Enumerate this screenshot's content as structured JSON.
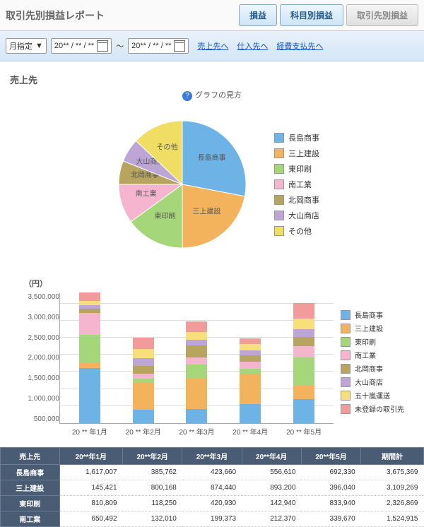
{
  "header": {
    "title": "取引先別損益レポート"
  },
  "tabs": [
    {
      "label": "損益"
    },
    {
      "label": "科目別損益"
    },
    {
      "label": "取引先別損益"
    }
  ],
  "filter": {
    "mode": "月指定",
    "date_from": "20** / ** / **",
    "date_to": "20** / ** / **",
    "sep": "～",
    "links": [
      "売上先へ",
      "仕入先へ",
      "経費支払先へ"
    ]
  },
  "section": {
    "title": "売上先",
    "howto": "グラフの見方"
  },
  "colors": {
    "長島商事": "#6db3e6",
    "三上建設": "#f2b35c",
    "東印刷": "#a6d67a",
    "南工業": "#f5b5cf",
    "北岡商事": "#b7a45e",
    "大山商店": "#bda6d6",
    "五十嵐運送": "#f7e07a",
    "その他": "#f0dd63",
    "未登録の取引先": "#f29b9b"
  },
  "pie": {
    "legend": [
      "長島商事",
      "三上建設",
      "東印刷",
      "南工業",
      "北岡商事",
      "大山商店",
      "その他"
    ],
    "slices": [
      {
        "name": "長島商事",
        "value": 28
      },
      {
        "name": "三上建設",
        "value": 22
      },
      {
        "name": "東印刷",
        "value": 15
      },
      {
        "name": "南工業",
        "value": 10
      },
      {
        "name": "北岡商事",
        "value": 6
      },
      {
        "name": "大山商店",
        "value": 6
      },
      {
        "name": "その他",
        "value": 13
      }
    ]
  },
  "chart_data": {
    "type": "bar",
    "stacked": true,
    "unit": "（円）",
    "categories": [
      "20 ** 年1月",
      "20 ** 年2月",
      "20 ** 年3月",
      "20 ** 年4月",
      "20 ** 年5月"
    ],
    "ylim": [
      0,
      3800000
    ],
    "yticks": [
      "3,500,000",
      "3,000,000",
      "2,500,000",
      "2,000,000",
      "1,500,000",
      "1,000,000",
      "500,000"
    ],
    "series": [
      {
        "name": "長島商事",
        "values": [
          1617007,
          385762,
          423660,
          556610,
          692330
        ]
      },
      {
        "name": "三上建設",
        "values": [
          145421,
          800168,
          874440,
          893200,
          396040
        ]
      },
      {
        "name": "東印刷",
        "values": [
          810809,
          118250,
          420930,
          142940,
          833940
        ]
      },
      {
        "name": "南工業",
        "values": [
          650492,
          132010,
          199373,
          212370,
          339670
        ]
      },
      {
        "name": "北岡商事",
        "values": [
          120000,
          240000,
          350000,
          180000,
          260000
        ]
      },
      {
        "name": "大山商店",
        "values": [
          110000,
          230000,
          180000,
          150000,
          220000
        ]
      },
      {
        "name": "五十嵐運送",
        "values": [
          130000,
          260000,
          220000,
          170000,
          320000
        ]
      },
      {
        "name": "未登録の取引先",
        "values": [
          230000,
          340000,
          310000,
          180000,
          460000
        ]
      }
    ],
    "legend": [
      "長島商事",
      "三上建設",
      "東印刷",
      "南工業",
      "北岡商事",
      "大山商店",
      "五十嵐運送",
      "未登録の取引先"
    ]
  },
  "table": {
    "headers": [
      "売上先",
      "20**年1月",
      "20**年2月",
      "20**年3月",
      "20**年4月",
      "20**年5月",
      "期間計"
    ],
    "rows": [
      {
        "name": "長島商事",
        "cells": [
          "1,617,007",
          "385,762",
          "423,660",
          "556,610",
          "692,330",
          "3,675,369"
        ]
      },
      {
        "name": "三上建設",
        "cells": [
          "145,421",
          "800,168",
          "874,440",
          "893,200",
          "396,040",
          "3,109,269"
        ]
      },
      {
        "name": "東印刷",
        "cells": [
          "810,809",
          "118,250",
          "420,930",
          "142,940",
          "833,940",
          "2,326,869"
        ]
      },
      {
        "name": "南工業",
        "cells": [
          "650,492",
          "132,010",
          "199,373",
          "212,370",
          "339,670",
          "1,524,915"
        ]
      }
    ]
  }
}
